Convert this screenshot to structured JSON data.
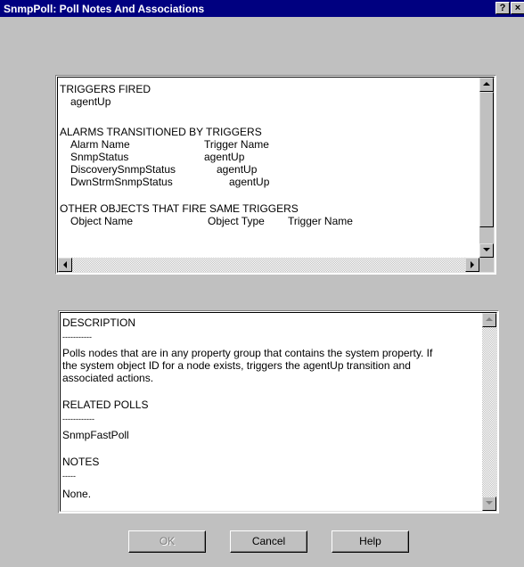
{
  "window": {
    "title": "SnmpPoll: Poll Notes And Associations",
    "help_glyph": "?",
    "close_glyph": "×"
  },
  "triggers_panel": {
    "triggers_fired_heading": "TRIGGERS FIRED",
    "triggers_fired": [
      "agentUp"
    ],
    "alarms_heading": "ALARMS TRANSITIONED BY TRIGGERS",
    "alarms_columns": {
      "alarm_name": "Alarm Name",
      "trigger_name": "Trigger Name"
    },
    "alarms_rows": [
      {
        "alarm": "SnmpStatus",
        "trigger": "agentUp"
      },
      {
        "alarm": "DiscoverySnmpStatus",
        "trigger": "agentUp"
      },
      {
        "alarm": "DwnStrmSnmpStatus",
        "trigger": "agentUp"
      }
    ],
    "other_heading": "OTHER OBJECTS THAT FIRE SAME TRIGGERS",
    "other_columns": {
      "object_name": "Object Name",
      "object_type": "Object Type",
      "trigger_name": "Trigger Name"
    }
  },
  "description_panel": {
    "description_heading": "DESCRIPTION",
    "description_rule": "-----------",
    "description_lines": [
      "Polls nodes that are in any property group that contains the system property. If",
      "the system object ID for a node exists, triggers the agentUp transition and",
      "associated actions."
    ],
    "related_heading": "RELATED POLLS",
    "related_rule": "------------",
    "related_polls": [
      "SnmpFastPoll"
    ],
    "notes_heading": "NOTES",
    "notes_rule": "-----",
    "notes_text": "None."
  },
  "buttons": {
    "ok": "OK",
    "cancel": "Cancel",
    "help": "Help"
  },
  "icons": {
    "scroll_up": "up-arrow-icon",
    "scroll_down": "down-arrow-icon",
    "scroll_left": "left-arrow-icon",
    "scroll_right": "right-arrow-icon"
  },
  "colors": {
    "titlebar": "#000080",
    "face": "#c0c0c0",
    "disabled_text": "#808080"
  }
}
